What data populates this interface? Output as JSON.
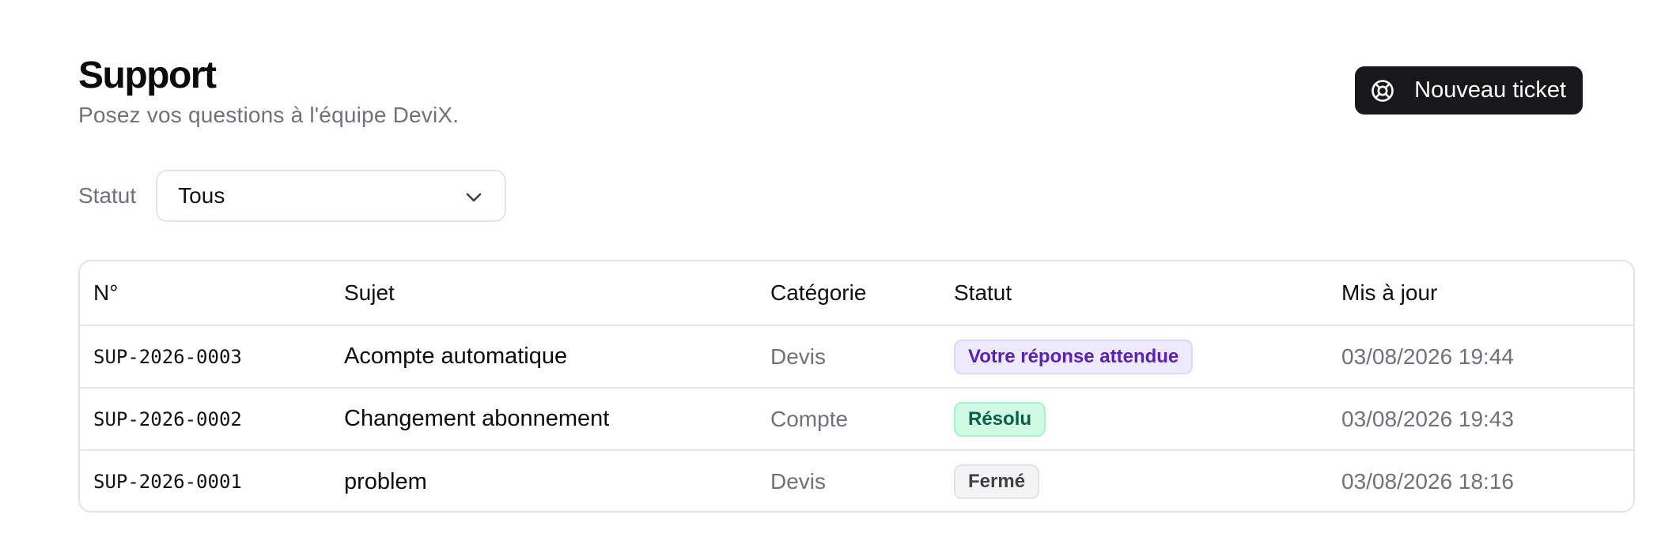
{
  "header": {
    "title": "Support",
    "subtitle": "Posez vos questions à l'équipe DeviX.",
    "new_ticket_label": "Nouveau ticket",
    "new_ticket_icon": "lifebuoy-icon"
  },
  "filter": {
    "label": "Statut",
    "selected": "Tous",
    "icon": "chevron-down-icon"
  },
  "table": {
    "columns": [
      "N°",
      "Sujet",
      "Catégorie",
      "Statut",
      "Mis à jour"
    ],
    "rows": [
      {
        "id": "SUP-2026-0003",
        "subject": "Acompte automatique",
        "category": "Devis",
        "status": "Votre réponse attendue",
        "updated": "03/08/2026 19:44"
      },
      {
        "id": "SUP-2026-0002",
        "subject": "Changement abonnement",
        "category": "Compte",
        "status": "Résolu",
        "updated": "03/08/2026 19:43"
      },
      {
        "id": "SUP-2026-0001",
        "subject": "problem",
        "category": "Devis",
        "status": "Fermé",
        "updated": "03/08/2026 18:16"
      }
    ]
  },
  "colors": {
    "primary_button": "#18181b",
    "muted_text": "#71717a",
    "border": "#e4e4e7",
    "badge_waiting": "#ede9fe",
    "badge_resolved": "#d1fae5",
    "badge_closed": "#f4f4f5"
  }
}
